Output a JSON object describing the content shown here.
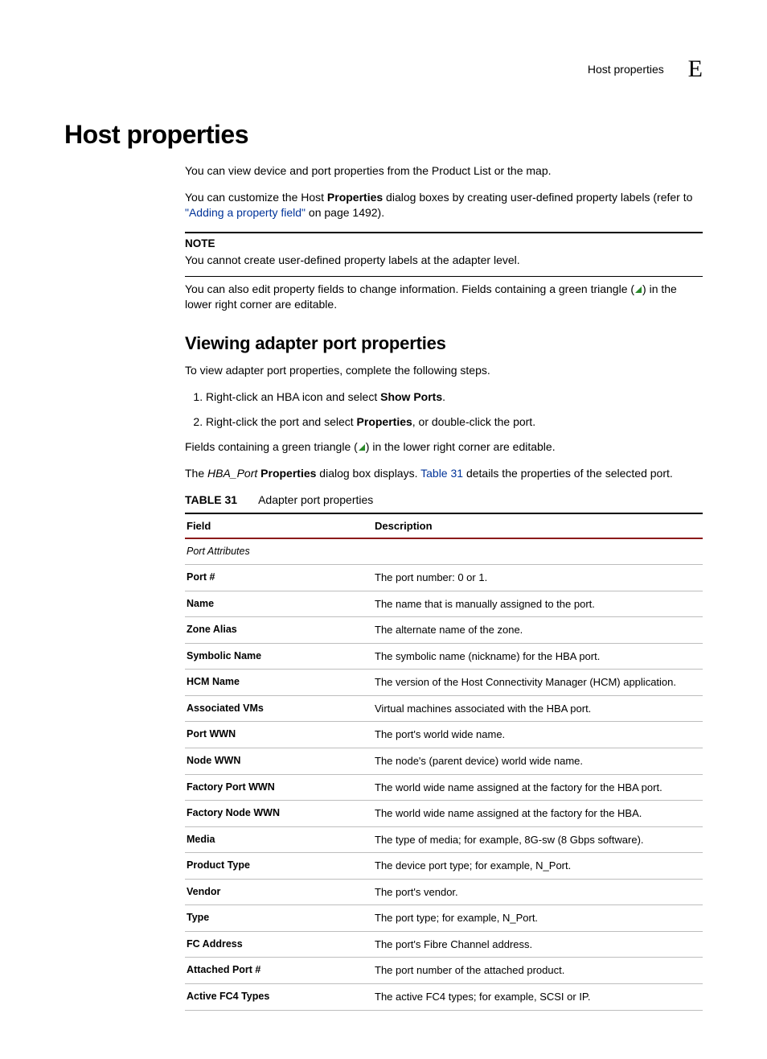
{
  "header": {
    "running_text": "Host properties",
    "appendix_letter": "E"
  },
  "section": {
    "title": "Host properties",
    "para1": "You can view device and port properties from the Product List or the map.",
    "para2a": "You can customize the Host ",
    "para2b_bold": "Properties",
    "para2c": " dialog boxes by creating user-defined property labels (refer to ",
    "para2_link": "\"Adding a property field\"",
    "para2d": " on page 1492).",
    "note_label": "NOTE",
    "note_text": "You cannot create user-defined property labels at the adapter level.",
    "para3a": "You can also edit property fields to change information. Fields containing a green triangle (",
    "para3b": ") in the lower right corner are editable."
  },
  "sub": {
    "title": "Viewing adapter port properties",
    "intro": "To view adapter port properties, complete the following steps.",
    "step1a": "Right-click an HBA icon and select ",
    "step1b_bold": "Show Ports",
    "step1c": ".",
    "step2a": "Right-click the port and select ",
    "step2b_bold": "Properties",
    "step2c": ", or double-click the port.",
    "fields_a": "Fields containing a green triangle (",
    "fields_b": ") in the lower right corner are editable.",
    "dlg_a": "The ",
    "dlg_b_italic": "HBA_Port",
    "dlg_c": " ",
    "dlg_d_bold": "Properties",
    "dlg_e": " dialog box displays. ",
    "dlg_link": "Table 31",
    "dlg_f": " details the properties of the selected port."
  },
  "table": {
    "number": "TABLE 31",
    "title": "Adapter port properties",
    "col_field": "Field",
    "col_desc": "Description",
    "group1": "Port Attributes",
    "rows": [
      {
        "field": "Port #",
        "desc": "The port number: 0 or 1."
      },
      {
        "field": "Name",
        "desc": "The name that is manually assigned to the port."
      },
      {
        "field": "Zone Alias",
        "desc": "The alternate name of the zone."
      },
      {
        "field": "Symbolic Name",
        "desc": "The symbolic name (nickname) for the HBA port."
      },
      {
        "field": "HCM Name",
        "desc": "The version of the Host Connectivity Manager (HCM) application."
      },
      {
        "field": "Associated VMs",
        "desc": "Virtual machines associated with the HBA port."
      },
      {
        "field": "Port WWN",
        "desc": "The port's world wide name."
      },
      {
        "field": "Node WWN",
        "desc": "The node's (parent device) world wide name."
      },
      {
        "field": "Factory Port WWN",
        "desc": "The world wide name assigned at the factory for the HBA port."
      },
      {
        "field": "Factory Node WWN",
        "desc": "The world wide name assigned at the factory for the HBA."
      },
      {
        "field": "Media",
        "desc": "The type of media; for example, 8G-sw (8 Gbps software)."
      },
      {
        "field": "Product Type",
        "desc": "The device port type; for example, N_Port."
      },
      {
        "field": "Vendor",
        "desc": "The port's vendor."
      },
      {
        "field": "Type",
        "desc": "The port type; for example, N_Port."
      },
      {
        "field": "FC Address",
        "desc": "The port's Fibre Channel address."
      },
      {
        "field": "Attached Port #",
        "desc": "The port number of the attached product."
      },
      {
        "field": "Active FC4 Types",
        "desc": "The active FC4 types; for example, SCSI or IP."
      }
    ]
  }
}
